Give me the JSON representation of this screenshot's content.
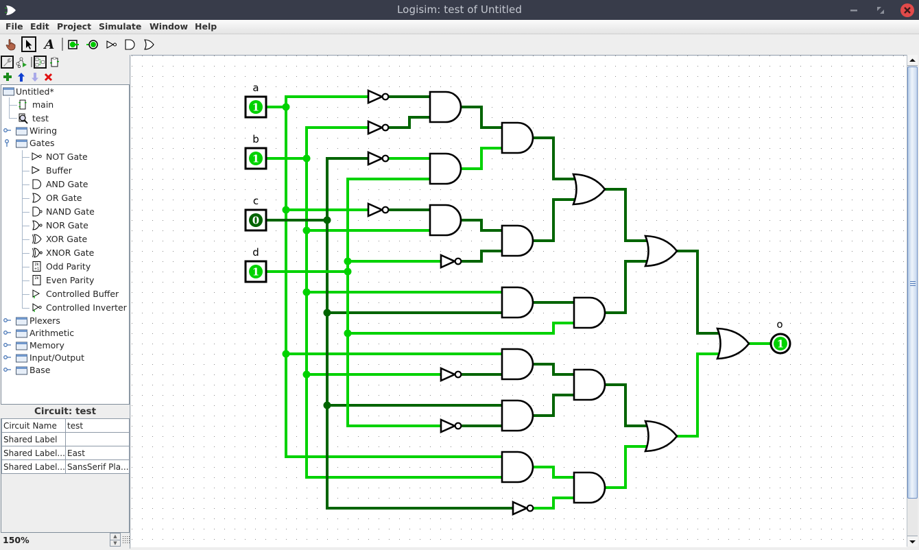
{
  "window": {
    "title": "Logisim: test of Untitled",
    "controls": [
      "minimize",
      "maximize",
      "close"
    ]
  },
  "menu": {
    "items": [
      "File",
      "Edit",
      "Project",
      "Simulate",
      "Window",
      "Help"
    ]
  },
  "toolbar": {
    "tools": [
      {
        "name": "poke-tool",
        "icon": "hand-icon",
        "selected": false
      },
      {
        "name": "select-tool",
        "icon": "arrow-icon",
        "selected": true
      },
      {
        "name": "text-tool",
        "icon": "text-A-icon",
        "selected": false
      },
      {
        "name": "input-pin",
        "icon": "input-pin-icon",
        "selected": false
      },
      {
        "name": "output-pin",
        "icon": "output-pin-icon",
        "selected": false
      },
      {
        "name": "not-gate",
        "icon": "not-gate-icon",
        "selected": false
      },
      {
        "name": "and-gate",
        "icon": "and-gate-icon",
        "selected": false
      },
      {
        "name": "or-gate",
        "icon": "or-gate-icon",
        "selected": false
      }
    ],
    "text_tool_glyph": "A"
  },
  "explorer_toolbar": {
    "items": [
      {
        "name": "project-toolbox",
        "icon": "wrench-icon",
        "selected": true
      },
      {
        "name": "simulation-hierarchy",
        "icon": "simulation-tree-icon",
        "selected": false
      },
      {
        "name": "edit-layout",
        "icon": "layout-icon",
        "selected": true
      },
      {
        "name": "edit-appearance",
        "icon": "appearance-icon",
        "selected": false
      }
    ],
    "project_actions": [
      {
        "name": "add-circuit",
        "glyph": "✚",
        "color": "#1a8a1a"
      },
      {
        "name": "move-up",
        "glyph": "🡅",
        "color": "#1040d0"
      },
      {
        "name": "move-down",
        "glyph": "🡇",
        "color": "#a9a9e8"
      },
      {
        "name": "remove-circuit",
        "glyph": "✖",
        "color": "#e01010"
      }
    ]
  },
  "tree": {
    "project": "Untitled*",
    "circuits": [
      {
        "label": "main"
      },
      {
        "label": "test"
      }
    ],
    "libraries": [
      {
        "label": "Wiring",
        "expanded": false
      },
      {
        "label": "Gates",
        "expanded": true
      },
      {
        "label": "Plexers",
        "expanded": false
      },
      {
        "label": "Arithmetic",
        "expanded": false
      },
      {
        "label": "Memory",
        "expanded": false
      },
      {
        "label": "Input/Output",
        "expanded": false
      },
      {
        "label": "Base",
        "expanded": false
      }
    ],
    "gates": [
      {
        "label": "NOT Gate"
      },
      {
        "label": "Buffer"
      },
      {
        "label": "AND Gate"
      },
      {
        "label": "OR Gate"
      },
      {
        "label": "NAND Gate"
      },
      {
        "label": "NOR Gate"
      },
      {
        "label": "XOR Gate"
      },
      {
        "label": "XNOR Gate"
      },
      {
        "label": "Odd Parity"
      },
      {
        "label": "Even Parity"
      },
      {
        "label": "Controlled Buffer"
      },
      {
        "label": "Controlled Inverter"
      }
    ]
  },
  "properties": {
    "title": "Circuit: test",
    "rows": [
      {
        "name": "Circuit Name",
        "value": "test"
      },
      {
        "name": "Shared Label",
        "value": ""
      },
      {
        "name": "Shared Label...",
        "value": "East"
      },
      {
        "name": "Shared Label...",
        "value": "SansSerif Pla..."
      }
    ]
  },
  "zoom": {
    "value": "150%"
  },
  "circuit": {
    "colors": {
      "high": "#00d200",
      "low": "#006400"
    },
    "inputs": [
      {
        "label": "a",
        "value": "1"
      },
      {
        "label": "b",
        "value": "1"
      },
      {
        "label": "c",
        "value": "0"
      },
      {
        "label": "d",
        "value": "1"
      }
    ],
    "output": {
      "label": "o",
      "value": "1"
    },
    "signals": {
      "a": 1,
      "b": 1,
      "c": 0,
      "d": 1,
      "not1": 0,
      "not2": 0,
      "not3": 1,
      "not4": 0,
      "not5": 0,
      "not6": 0,
      "not7": 0,
      "not8": 1,
      "and1": 0,
      "and2": 1,
      "and3": 0,
      "and4": 0,
      "and5": 0,
      "and6": 0,
      "and7": 0,
      "and8": 0,
      "and9": 0,
      "and10": 0,
      "and11": 1,
      "and12": 1,
      "or1": 0,
      "or2": 0,
      "or3": 1,
      "or4": 1
    }
  }
}
